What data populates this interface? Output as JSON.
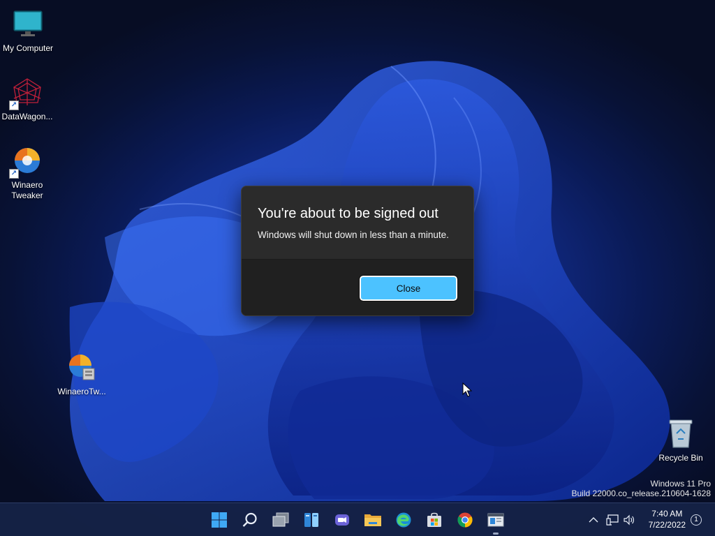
{
  "desktop": {
    "icons": [
      {
        "label": "My Computer",
        "icon": "monitor-icon"
      },
      {
        "label": "DataWagon...",
        "icon": "datawagon-icon"
      },
      {
        "label": "Winaero\nTweaker",
        "icon": "winaero-tweaker-icon"
      },
      {
        "label": "WinaeroTw...",
        "icon": "winaero-tweaker-installer-icon"
      },
      {
        "label": "Recycle Bin",
        "icon": "recycle-bin-icon"
      }
    ]
  },
  "dialog": {
    "title": "You're about to be signed out",
    "message": "Windows will shut down in less than a minute.",
    "close_label": "Close"
  },
  "watermark": {
    "edition": "Windows 11 Pro",
    "build": "Build 22000.co_release.210604-1628"
  },
  "taskbar": {
    "apps": [
      {
        "name": "start-button",
        "icon": "windows-logo-icon"
      },
      {
        "name": "search-button",
        "icon": "search-icon"
      },
      {
        "name": "task-view-button",
        "icon": "task-view-icon"
      },
      {
        "name": "widgets-button",
        "icon": "widgets-icon"
      },
      {
        "name": "chat-button",
        "icon": "chat-icon"
      },
      {
        "name": "file-explorer-button",
        "icon": "folder-icon"
      },
      {
        "name": "edge-button",
        "icon": "edge-icon"
      },
      {
        "name": "store-button",
        "icon": "store-icon"
      },
      {
        "name": "chrome-button",
        "icon": "chrome-icon"
      },
      {
        "name": "active-app-button",
        "icon": "app-window-icon"
      }
    ],
    "tray": {
      "time": "7:40 AM",
      "date": "7/22/2022",
      "notification_count": "1"
    }
  },
  "colors": {
    "accent": "#4cc2ff",
    "dialog_bg": "#2b2b2b",
    "dialog_footer": "#202020"
  }
}
